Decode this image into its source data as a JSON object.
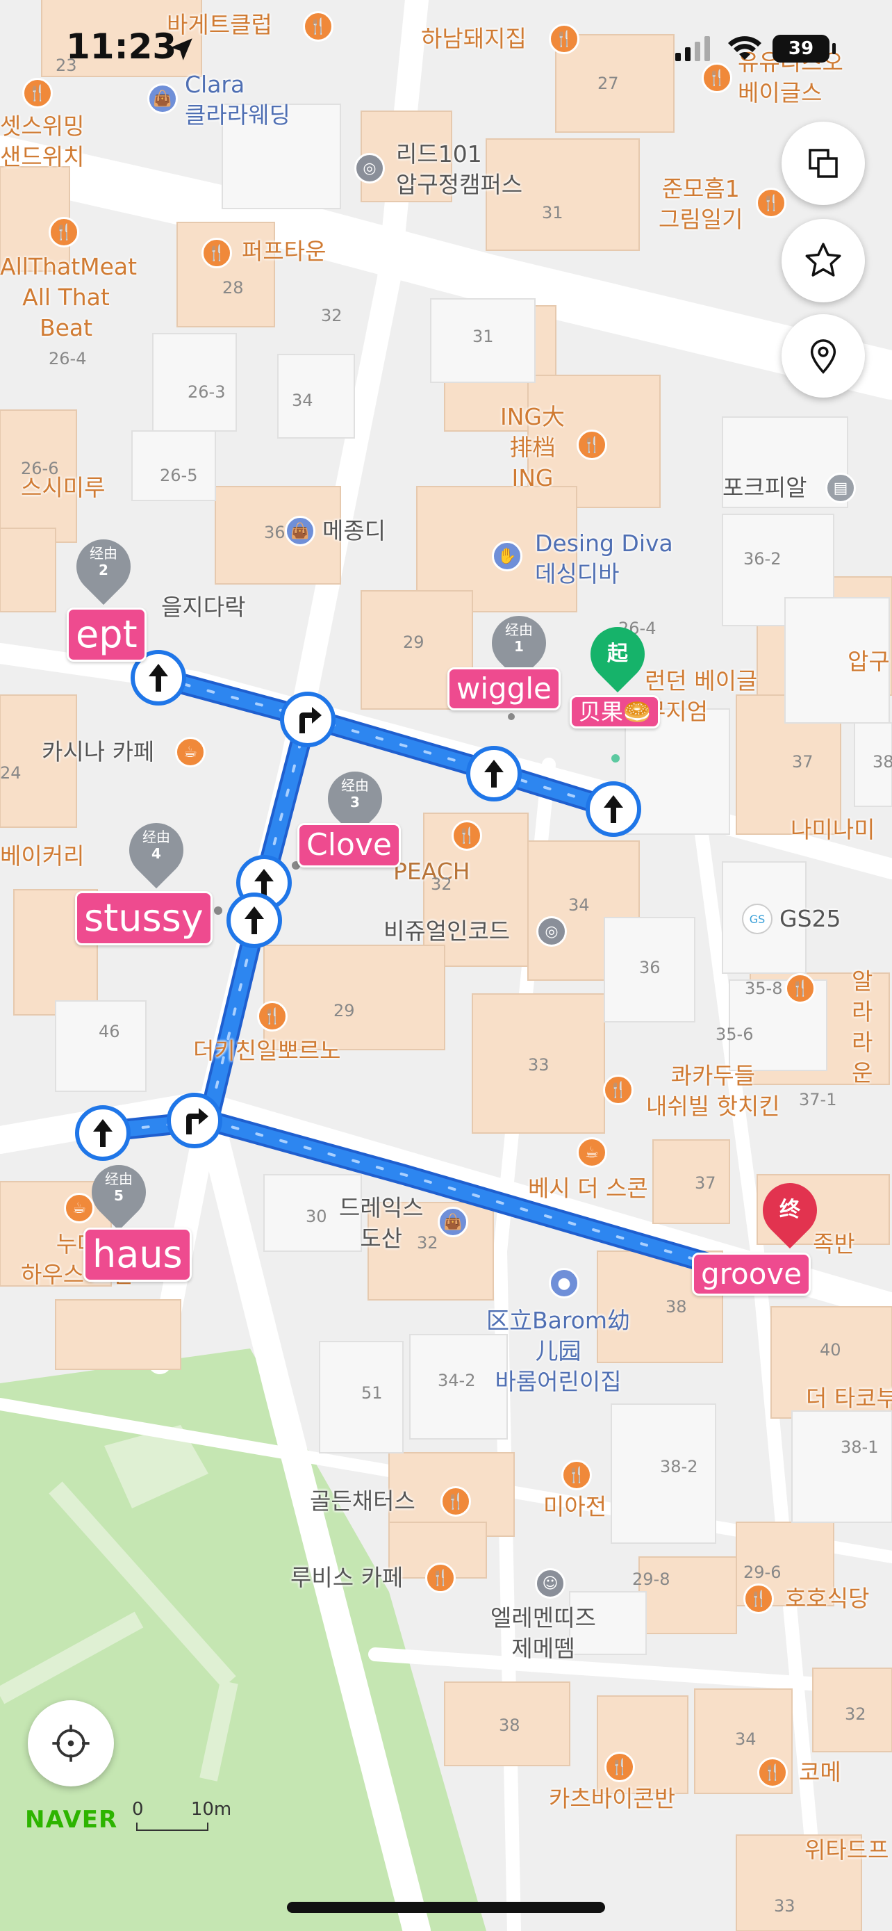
{
  "status_bar": {
    "time": "11:23",
    "battery": "39"
  },
  "map": {
    "labels": {
      "bagette": "바게트클럽",
      "hanam": "하남돼지집",
      "youtalk": "유유리즈오\n베이글스",
      "clara": "Clara\n클라라웨딩",
      "sets": "셋스위밍\n샌드위치",
      "lead101": "리드101\n압구정캠퍼스",
      "junmo": "준모흠1\n그림일기",
      "perfume": "퍼프타운",
      "allthat": "AllThatMeat\nAll That\nBeat",
      "ing": "ING大\n排档\nING",
      "porkpial": "포크피알",
      "sisimiru": "스시미루",
      "mejongdi": "메종디",
      "desingdiva": "Desing Diva\n데싱디바",
      "euljidarak": "을지다락",
      "london": "런던 베이글\n뮤지엄",
      "apgu": "압구",
      "cashina": "카시나 카페",
      "naminami": "나미나미",
      "bakery": "베이커리",
      "peach": "PEACH",
      "visual": "비쥬얼인코드",
      "gs25": "GS25",
      "alra": "알라\n라운",
      "dakichin": "더키친일뽀르노",
      "kakadu": "콰카두들\n내쉬빌 핫치킨",
      "besi": "베시 더 스콘",
      "dreamx": "드레익스\n도산",
      "juban": "족반",
      "nude": "누데\n하우스 도산",
      "barom": "区立Barom幼\n儿园\n바롬어린이집",
      "dataco": "더 타코부",
      "golden": "골든채터스",
      "miajeon": "미아전",
      "rubis": "루비스 카페",
      "elements": "엘레멘띠즈\n제메뗌",
      "hoho": "호호식당",
      "katsu": "카츠바이콘반",
      "kome": "코메",
      "witad": "위타드프"
    },
    "building_numbers": [
      "23",
      "27",
      "31",
      "28",
      "32",
      "31",
      "26-4",
      "26-3",
      "34",
      "26-6",
      "26-5",
      "36",
      "36-2",
      "26-4",
      "29",
      "37",
      "38",
      "24",
      "32",
      "34",
      "35-8",
      "36",
      "35-6",
      "46",
      "29",
      "33",
      "37-1",
      "37",
      "30",
      "32",
      "38",
      "40",
      "51",
      "34-2",
      "38-2",
      "38-1",
      "29-8",
      "29-6",
      "38",
      "34",
      "32",
      "33"
    ],
    "route_tags": {
      "ept": "ept",
      "wiggle": "wiggle",
      "clove": "Clove",
      "stussy": "stussy",
      "haus": "haus",
      "groove": "groove",
      "start_name": "贝果🥯"
    },
    "waypoints": [
      {
        "label": "经由",
        "num": "2"
      },
      {
        "label": "经由",
        "num": "1"
      },
      {
        "label": "经由",
        "num": "3"
      },
      {
        "label": "经由",
        "num": "4"
      },
      {
        "label": "经由",
        "num": "5"
      }
    ],
    "start_marker": "起",
    "end_marker": "终"
  },
  "controls": {
    "layers_icon": "layers-icon",
    "favorite_icon": "star-icon",
    "location_pin_icon": "location-pin-icon",
    "current_location_icon": "crosshair-icon"
  },
  "brand": "NAVER",
  "scale": {
    "zero": "0",
    "distance": "10m"
  },
  "colors": {
    "route": "#1f76e8",
    "tag": "#ee4b8f",
    "start": "#16b36a",
    "end": "#e2334f",
    "park": "#c5e6b2"
  }
}
